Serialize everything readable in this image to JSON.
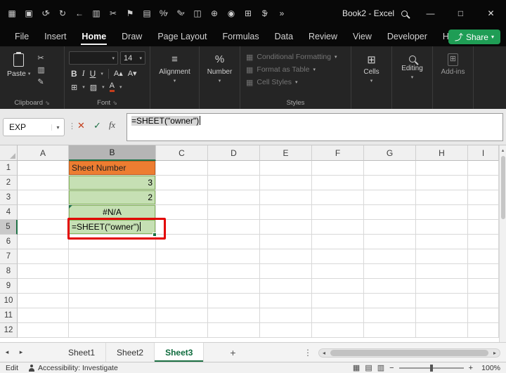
{
  "icons": {
    "chevron_down": "▾",
    "chevron_left": "◂",
    "chevron_right": "▸",
    "up_arrow": "▴",
    "ellipsis_v": "⋮",
    "launcher": "⇘",
    "borders": "⊞",
    "fill": "▨",
    "font_color": "A",
    "align": "≡",
    "percent": "%",
    "style_box": "▦",
    "cells": "⊞",
    "addins": "⊞",
    "share": "⤴",
    "view_normal": "▦",
    "view_layout": "▤",
    "view_break": "▥",
    "cut": "✂",
    "copy": "▥",
    "painter": "✎"
  },
  "titlebar": {
    "title": "Book2 - Excel",
    "minimize": "—",
    "maximize": "□",
    "close": "✕",
    "quick_access": [
      {
        "name": "menu",
        "glyph": "▦"
      },
      {
        "name": "save",
        "glyph": "▣"
      },
      {
        "name": "undo",
        "glyph": "↺",
        "menu": true
      },
      {
        "name": "redo",
        "glyph": "↻"
      },
      {
        "name": "back",
        "glyph": "←"
      },
      {
        "name": "copy",
        "glyph": "▥"
      },
      {
        "name": "cut",
        "glyph": "✂"
      },
      {
        "name": "flag",
        "glyph": "⚑"
      },
      {
        "name": "printer",
        "glyph": "▤"
      },
      {
        "name": "percent",
        "glyph": "%",
        "menu": true
      },
      {
        "name": "brush",
        "glyph": "✎",
        "menu": true
      },
      {
        "name": "book",
        "glyph": "◫"
      },
      {
        "name": "insert",
        "glyph": "⊕"
      },
      {
        "name": "camera",
        "glyph": "◉"
      },
      {
        "name": "table",
        "glyph": "⊞"
      },
      {
        "name": "currency",
        "glyph": "$",
        "menu": true
      },
      {
        "name": "overflow",
        "glyph": "»"
      }
    ]
  },
  "menubar": {
    "items": [
      "File",
      "Insert",
      "Home",
      "Draw",
      "Page Layout",
      "Formulas",
      "Data",
      "Review",
      "View",
      "Developer",
      "Help"
    ],
    "active": "Home",
    "share": "Share"
  },
  "ribbon": {
    "clipboard": {
      "paste": "Paste",
      "label": "Clipboard"
    },
    "font": {
      "size": "14",
      "bold": "B",
      "italic": "I",
      "underline": "U",
      "grow": "A▴",
      "shrink": "A▾",
      "label": "Font"
    },
    "alignment": {
      "label": "Alignment"
    },
    "number": {
      "label": "Number"
    },
    "styles": {
      "items": [
        "Conditional Formatting",
        "Format as Table",
        "Cell Styles"
      ],
      "label": "Styles"
    },
    "cells": {
      "label": "Cells"
    },
    "editing": {
      "label": "Editing"
    },
    "addins": {
      "label": "Add-ins"
    }
  },
  "formula_bar": {
    "name_box": "EXP",
    "cancel": "✕",
    "enter": "✓",
    "fx": "fx",
    "formula": "=SHEET(\"owner\")"
  },
  "grid": {
    "columns": [
      "A",
      "B",
      "C",
      "D",
      "E",
      "F",
      "G",
      "H",
      "I"
    ],
    "rows": [
      "1",
      "2",
      "3",
      "4",
      "5",
      "6",
      "7",
      "8",
      "9",
      "10",
      "11",
      "12"
    ],
    "selection": {
      "column": "B",
      "row": "5"
    },
    "cells": [
      {
        "ref": "B1",
        "text": "Sheet Number",
        "fill": "#ED7D31",
        "text_color": "#1f1f1f",
        "align": "left",
        "border": "#C05F20"
      },
      {
        "ref": "B2",
        "text": "3",
        "fill": "#C6E0B4",
        "align": "right",
        "border": "#86B65E"
      },
      {
        "ref": "B3",
        "text": "2",
        "fill": "#C6E0B4",
        "align": "right",
        "border": "#86B65E"
      },
      {
        "ref": "B4",
        "text": "#N/A",
        "fill": "#C6E0B4",
        "align": "center",
        "border": "#86B65E",
        "error_indicator": true
      },
      {
        "ref": "B5",
        "text": "=SHEET(\"owner\")",
        "fill": "#C6E0B4",
        "align": "left",
        "border": "#86B65E",
        "editing": true
      }
    ],
    "annotation_color": "#E30000"
  },
  "sheet_tabs": {
    "tabs": [
      "Sheet1",
      "Sheet2",
      "Sheet3"
    ],
    "active": "Sheet3",
    "add": "+"
  },
  "status_bar": {
    "mode": "Edit",
    "accessibility": "Accessibility: Investigate",
    "zoom_out": "−",
    "zoom_in": "+",
    "zoom": "100%"
  }
}
